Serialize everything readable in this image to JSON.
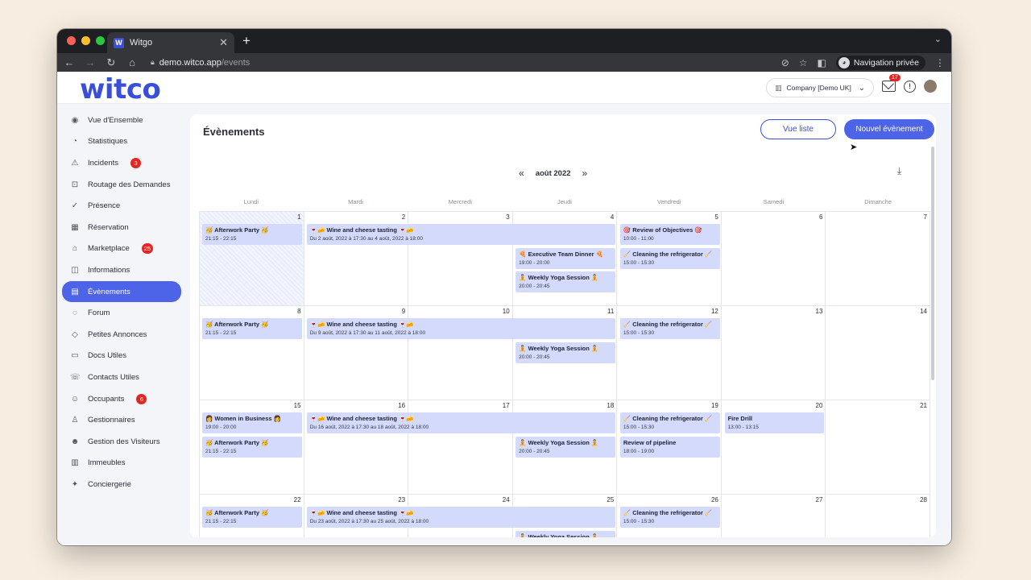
{
  "browser": {
    "tab_title": "Witgo",
    "tab_favicon": "W",
    "url_host": "demo.witco.app",
    "url_path": "/events",
    "private_label": "Navigation privée"
  },
  "header": {
    "logo": "witco",
    "company": "Company [Demo UK]",
    "mail_badge": "17"
  },
  "sidebar": {
    "items": [
      {
        "label": "Vue d'Ensemble",
        "icon": "eye-icon",
        "glyph": "◉"
      },
      {
        "label": "Statistiques",
        "icon": "pie-chart-icon",
        "glyph": "◔"
      },
      {
        "label": "Incidents",
        "icon": "warning-icon",
        "glyph": "⚠",
        "badge": "3"
      },
      {
        "label": "Routage des Demandes",
        "icon": "route-icon",
        "glyph": "⊡"
      },
      {
        "label": "Présence",
        "icon": "check-circle-icon",
        "glyph": "✓"
      },
      {
        "label": "Réservation",
        "icon": "calendar-icon",
        "glyph": "▦"
      },
      {
        "label": "Marketplace",
        "icon": "store-icon",
        "glyph": "⌂",
        "badge": "25"
      },
      {
        "label": "Informations",
        "icon": "chat-icon",
        "glyph": "◫"
      },
      {
        "label": "Évènements",
        "icon": "event-icon",
        "glyph": "▤",
        "active": true
      },
      {
        "label": "Forum",
        "icon": "forum-icon",
        "glyph": "◌"
      },
      {
        "label": "Petites Annonces",
        "icon": "tag-icon",
        "glyph": "◇"
      },
      {
        "label": "Docs Utiles",
        "icon": "document-icon",
        "glyph": "▭"
      },
      {
        "label": "Contacts Utiles",
        "icon": "phone-icon",
        "glyph": "☏"
      },
      {
        "label": "Occupants",
        "icon": "users-icon",
        "glyph": "☺",
        "badge": "6"
      },
      {
        "label": "Gestionnaires",
        "icon": "user-icon",
        "glyph": "♙"
      },
      {
        "label": "Gestion des Visiteurs",
        "icon": "visitors-icon",
        "glyph": "☻"
      },
      {
        "label": "Immeubles",
        "icon": "building-icon",
        "glyph": "▥"
      },
      {
        "label": "Conciergerie",
        "icon": "concierge-icon",
        "glyph": "✦"
      }
    ]
  },
  "main": {
    "title": "Évènements",
    "btn_list": "Vue liste",
    "btn_new": "Nouvel évènement",
    "month": "août 2022",
    "nav_prev": "«",
    "nav_next": "»",
    "weekdays": [
      "Lundi",
      "Mardi",
      "Mercredi",
      "Jeudi",
      "Vendredi",
      "Samedi",
      "Dimanche"
    ],
    "days": [
      1,
      2,
      3,
      4,
      5,
      6,
      7,
      8,
      9,
      10,
      11,
      12,
      13,
      14,
      15,
      16,
      17,
      18,
      19,
      20,
      21,
      22,
      23,
      24,
      25,
      26,
      27,
      28
    ]
  },
  "events": [
    {
      "week": 0,
      "col": 0,
      "span": 1,
      "slot": 0,
      "title": "🥳 Afterwork Party 🥳",
      "time": "21:15 - 22:15"
    },
    {
      "week": 0,
      "col": 1,
      "span": 3,
      "slot": 0,
      "title": "🍷🧀 Wine and cheese tasting 🍷🧀",
      "time": "Du 2 août, 2022 à 17:30 au 4 août, 2022 à 18:00"
    },
    {
      "week": 0,
      "col": 3,
      "span": 1,
      "slot": 1,
      "title": "🍕 Executive Team Dinner 🍕",
      "time": "19:00 - 20:00"
    },
    {
      "week": 0,
      "col": 3,
      "span": 1,
      "slot": 2,
      "title": "🧘 Weekly Yoga Session 🧘",
      "time": "20:00 - 20:45"
    },
    {
      "week": 0,
      "col": 4,
      "span": 1,
      "slot": 0,
      "title": "🎯 Review of Objectives 🎯",
      "time": "10:00 - 11:00"
    },
    {
      "week": 0,
      "col": 4,
      "span": 1,
      "slot": 1,
      "title": "🧹 Cleaning the refrigerator 🧹",
      "time": "15:00 - 15:30"
    },
    {
      "week": 1,
      "col": 0,
      "span": 1,
      "slot": 0,
      "title": "🥳 Afterwork Party 🥳",
      "time": "21:15 - 22:15"
    },
    {
      "week": 1,
      "col": 1,
      "span": 3,
      "slot": 0,
      "title": "🍷🧀 Wine and cheese tasting 🍷🧀",
      "time": "Du 9 août, 2022 à 17:30 au 11 août, 2022 à 18:00"
    },
    {
      "week": 1,
      "col": 3,
      "span": 1,
      "slot": 1,
      "title": "🧘 Weekly Yoga Session 🧘",
      "time": "20:00 - 20:45"
    },
    {
      "week": 1,
      "col": 4,
      "span": 1,
      "slot": 0,
      "title": "🧹 Cleaning the refrigerator 🧹",
      "time": "15:00 - 15:30"
    },
    {
      "week": 2,
      "col": 0,
      "span": 1,
      "slot": 0,
      "title": "👩 Women in Business 👩",
      "time": "19:00 - 20:00"
    },
    {
      "week": 2,
      "col": 0,
      "span": 1,
      "slot": 1,
      "title": "🥳 Afterwork Party 🥳",
      "time": "21:15 - 22:15"
    },
    {
      "week": 2,
      "col": 1,
      "span": 3,
      "slot": 0,
      "title": "🍷🧀 Wine and cheese tasting 🍷🧀",
      "time": "Du 16 août, 2022 à 17:30 au 18 août, 2022 à 18:00"
    },
    {
      "week": 2,
      "col": 3,
      "span": 1,
      "slot": 1,
      "title": "🧘 Weekly Yoga Session 🧘",
      "time": "20:00 - 20:45"
    },
    {
      "week": 2,
      "col": 4,
      "span": 1,
      "slot": 0,
      "title": "🧹 Cleaning the refrigerator 🧹",
      "time": "15:00 - 15:30"
    },
    {
      "week": 2,
      "col": 4,
      "span": 1,
      "slot": 1,
      "title": "Review of pipeline",
      "time": "18:00 - 19:00"
    },
    {
      "week": 2,
      "col": 5,
      "span": 1,
      "slot": 0,
      "title": "Fire Drill",
      "time": "13:00 - 13:15"
    },
    {
      "week": 3,
      "col": 0,
      "span": 1,
      "slot": 0,
      "title": "🥳 Afterwork Party 🥳",
      "time": "21:15 - 22:15"
    },
    {
      "week": 3,
      "col": 1,
      "span": 3,
      "slot": 0,
      "title": "🍷🧀 Wine and cheese tasting 🍷🧀",
      "time": "Du 23 août, 2022 à 17:30 au 25 août, 2022 à 18:00"
    },
    {
      "week": 3,
      "col": 3,
      "span": 1,
      "slot": 1,
      "title": "🧘 Weekly Yoga Session 🧘",
      "time": ""
    },
    {
      "week": 3,
      "col": 4,
      "span": 1,
      "slot": 0,
      "title": "🧹 Cleaning the refrigerator 🧹",
      "time": "15:00 - 15:30"
    }
  ],
  "help_label": "?",
  "colors": {
    "accent": "#4d63e8",
    "event_bg": "#d3dafb",
    "badge": "#e52521"
  }
}
